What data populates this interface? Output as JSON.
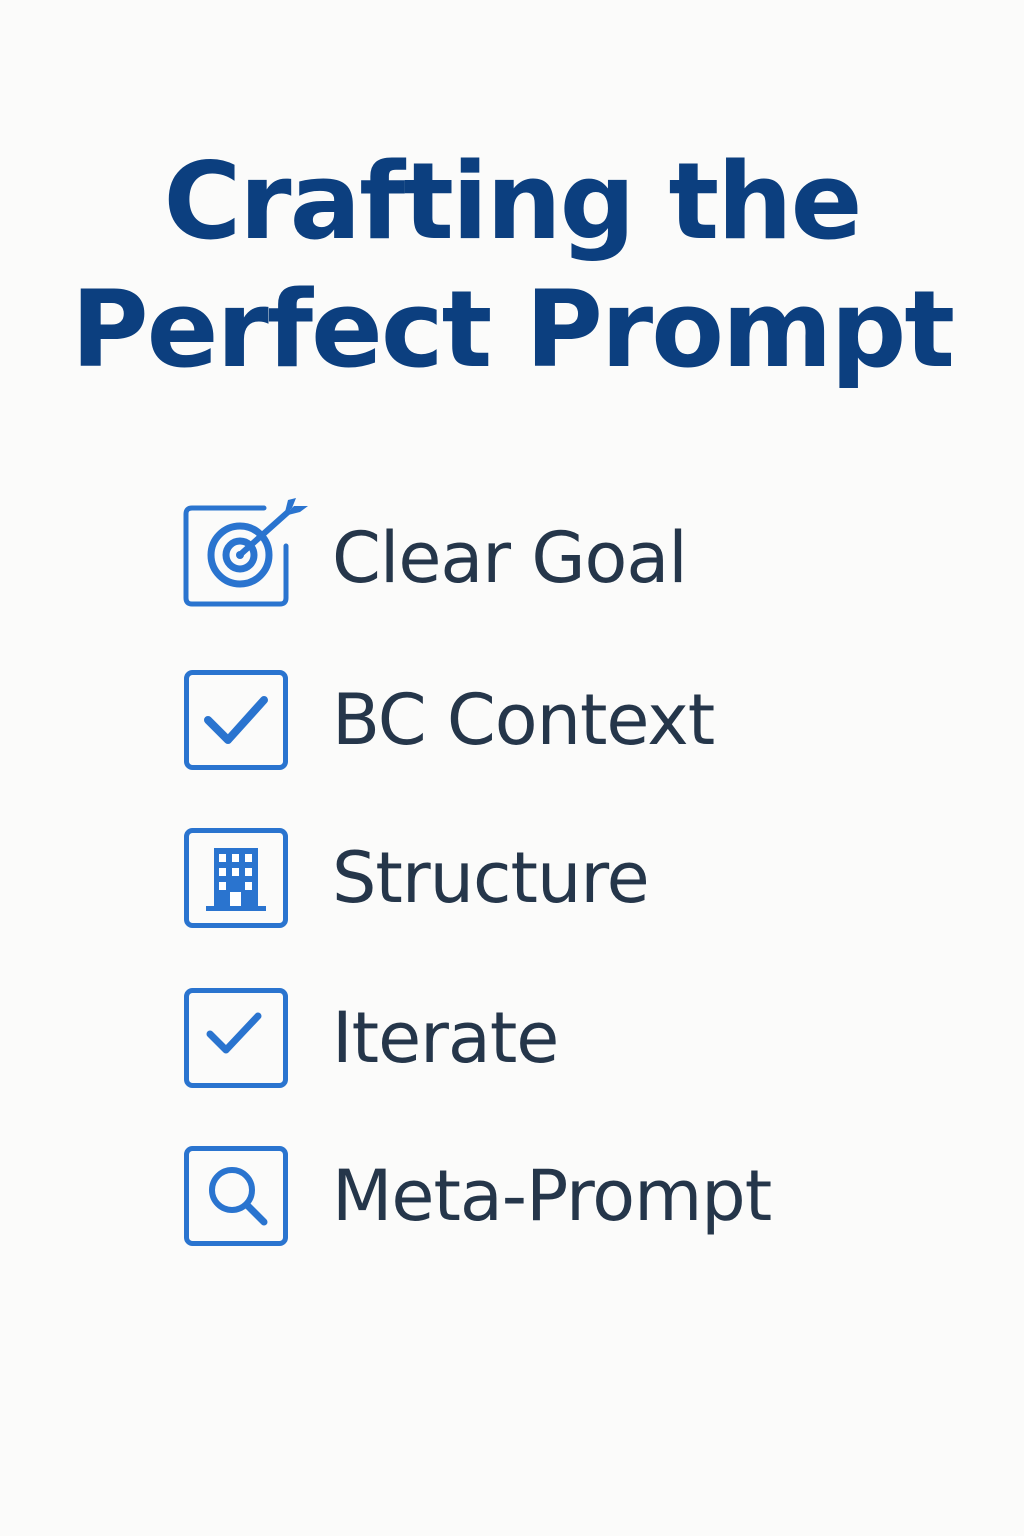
{
  "title": {
    "line1": "Crafting the",
    "line2": "Perfect Prompt"
  },
  "accent_color": "#2a74cf",
  "title_color": "#0c3f7f",
  "text_color": "#25364a",
  "items": [
    {
      "label": "Clear Goal",
      "icon": "target-arrow-icon"
    },
    {
      "label": "BC Context",
      "icon": "checkmark-icon"
    },
    {
      "label": "Structure",
      "icon": "building-icon"
    },
    {
      "label": "Iterate",
      "icon": "checkmark-icon"
    },
    {
      "label": "Meta-Prompt",
      "icon": "magnifier-icon"
    }
  ]
}
